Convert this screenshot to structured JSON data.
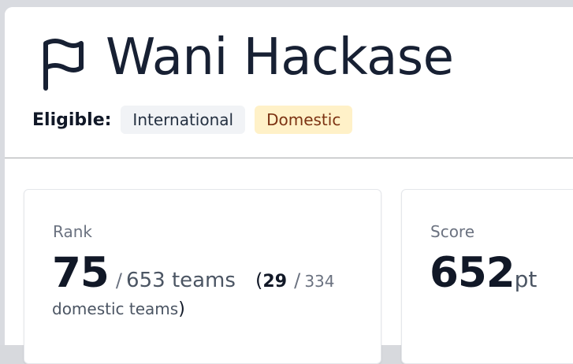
{
  "header": {
    "title": "Wani Hackase",
    "eligible_label": "Eligible:",
    "badges": [
      {
        "label": "International"
      },
      {
        "label": "Domestic"
      }
    ]
  },
  "icons": {
    "title_icon": "flag-icon"
  },
  "rank_card": {
    "label": "Rank",
    "rank": "75",
    "slash": "/",
    "total_teams": "653 teams",
    "open_paren": "(",
    "domestic_rank": "29",
    "domestic_slash": "/",
    "domestic_total": "334",
    "domestic_teams_label": "domestic teams",
    "close_paren": ")"
  },
  "score_card": {
    "label": "Score",
    "value": "652",
    "unit": "pt"
  },
  "colors": {
    "title_text": "#172033",
    "international_badge_bg": "#f1f3f6",
    "domestic_badge_bg": "#fff1c8",
    "domestic_badge_text": "#7c3212",
    "muted_text": "#6b7280",
    "divider": "#a5a7aa"
  }
}
